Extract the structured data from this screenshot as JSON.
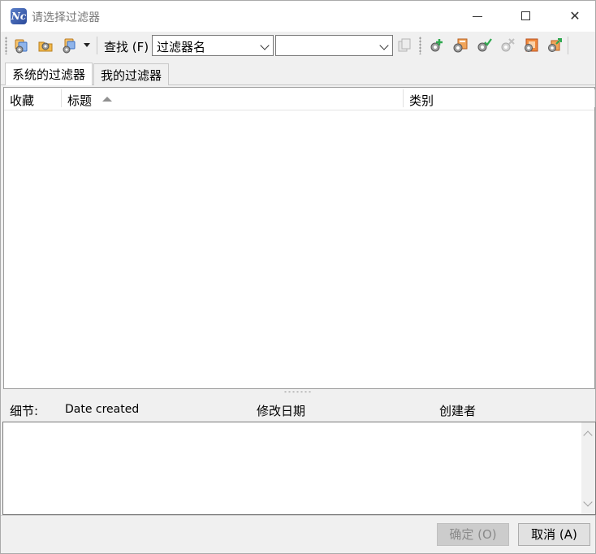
{
  "window": {
    "title": "请选择过滤器",
    "app_icon_text": "Nc"
  },
  "toolbar": {
    "find_label": "查找 (F)",
    "field_combo_value": "过滤器名",
    "search_combo_value": ""
  },
  "tabs": [
    {
      "label": "系统的过滤器",
      "active": true
    },
    {
      "label": "我的过滤器",
      "active": false
    }
  ],
  "list": {
    "columns": [
      "收藏",
      "标题",
      "类别"
    ],
    "sorted_column": "标题",
    "sort_direction": "ascending",
    "rows": []
  },
  "details": {
    "label": "细节:",
    "date_created_label": "Date created",
    "modified_label": "修改日期",
    "creator_label": "创建者",
    "description": ""
  },
  "buttons": {
    "ok": "确定 (O)",
    "ok_enabled": false,
    "cancel": "取消 (A)"
  },
  "colors": {
    "window_bg": "#f0f0f0",
    "content_bg": "#ffffff",
    "disabled_button": "#cccccc",
    "icon_orange": "#e8912d",
    "icon_blue": "#3a6fc4",
    "icon_green": "#2fa84f"
  },
  "icons": [
    "filter-gears-icon",
    "open-folder-filter-icon",
    "filter-menu-icon",
    "copy-icon",
    "add-filter-icon",
    "edit-filter-icon",
    "apply-filter-icon",
    "delete-filter-icon",
    "import-filter-icon",
    "export-filter-icon"
  ]
}
